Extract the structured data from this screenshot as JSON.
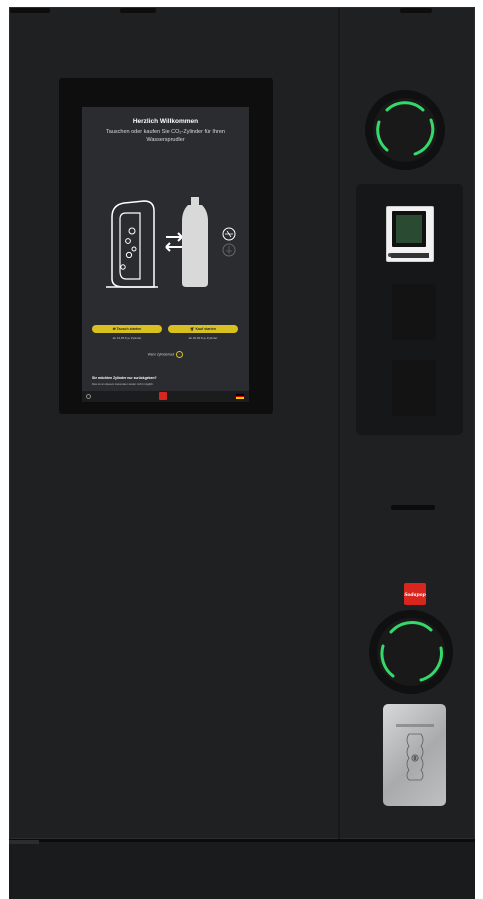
{
  "screen": {
    "title": "Herzlich Willkommen",
    "subtitle": "Tauschen oder kaufen Sie CO₂-Zylinder für Ihren Wassersprudler",
    "swap_button": "Tausch starten",
    "buy_button": "Kauf starten",
    "swap_price": "ab 13,95 € je Zylinder",
    "buy_price": "ab 26,99 € je Zylinder",
    "rent_label": "Wenn Zylinderkauf",
    "return_question": "Sie möchten Zylinder nur zurückgeben?",
    "return_note": "Das ist an diesem Automaten leider nicht möglich.",
    "language_flag": [
      "#000000",
      "#dd0000",
      "#ffce00"
    ]
  },
  "brand": {
    "logo_text": "Sodapop"
  },
  "colors": {
    "machine_body": "#1f2022",
    "accent_yellow": "#d8c021",
    "ring_led_green": "#35d96a",
    "brand_red": "#d8261f"
  },
  "icons": {
    "screen_settings": "settings-icon",
    "rent_info": "info-icon",
    "swap_button": "swap-arrows-icon",
    "buy_button": "cart-icon"
  }
}
